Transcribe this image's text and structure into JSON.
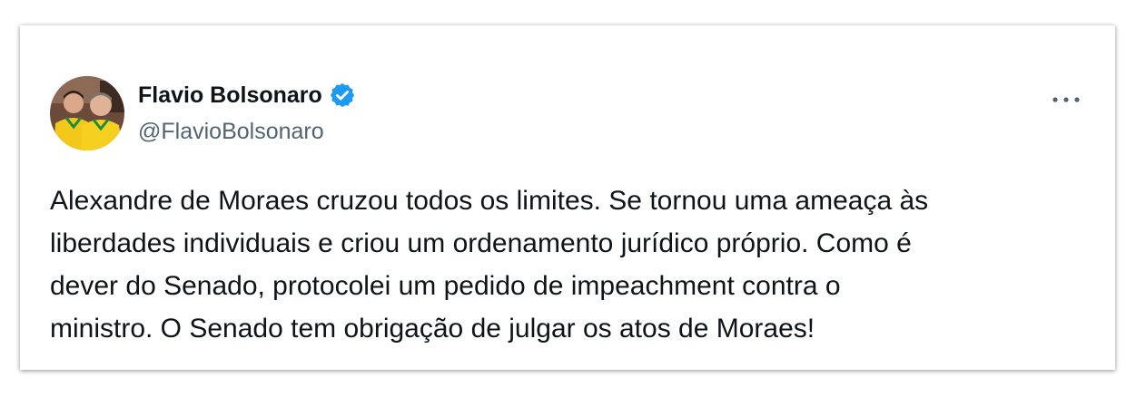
{
  "author": {
    "name": "Flavio Bolsonaro",
    "handle": "@FlavioBolsonaro",
    "verified": true,
    "verified_color": "#1d9bf0"
  },
  "more_icon": "more-horizontal-icon",
  "tweet": {
    "lines": [
      "Alexandre de Moraes cruzou todos os limites. Se tornou uma ameaça às",
      "liberdades individuais e criou um ordenamento jurídico próprio. Como é",
      "dever do Senado, protocolei um pedido de impeachment contra o",
      "ministro. O Senado tem obrigação de julgar os atos de Moraes!"
    ]
  },
  "colors": {
    "text_primary": "#0f1419",
    "text_secondary": "#536471"
  }
}
